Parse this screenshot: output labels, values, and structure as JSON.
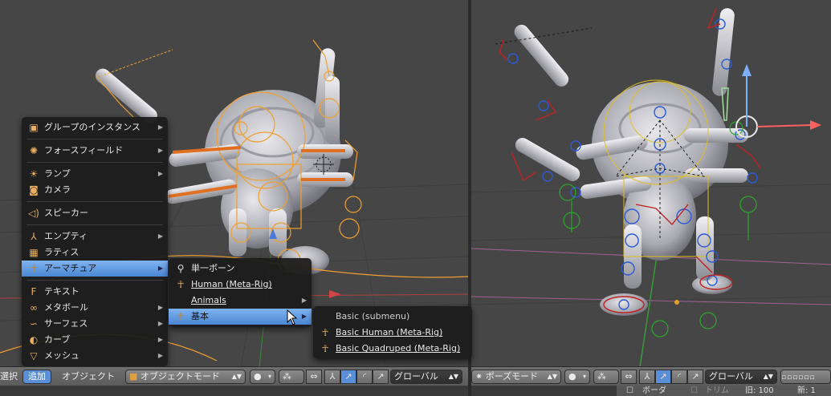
{
  "add_menu": {
    "items": [
      {
        "label": "グループのインスタンス",
        "icon": "group-icon",
        "submenu": true
      },
      {
        "label": "フォースフィールド",
        "icon": "force-field-icon",
        "submenu": true
      },
      {
        "label": "ランプ",
        "icon": "lamp-icon",
        "submenu": true
      },
      {
        "label": "カメラ",
        "icon": "camera-icon",
        "submenu": false
      },
      {
        "label": "スピーカー",
        "icon": "speaker-icon",
        "submenu": false
      },
      {
        "label": "エンプティ",
        "icon": "empty-icon",
        "submenu": true
      },
      {
        "label": "ラティス",
        "icon": "lattice-icon",
        "submenu": false
      },
      {
        "label": "アーマチュア",
        "icon": "armature-icon",
        "submenu": true
      },
      {
        "label": "テキスト",
        "icon": "text-icon",
        "submenu": false
      },
      {
        "label": "メタボール",
        "icon": "metaball-icon",
        "submenu": true
      },
      {
        "label": "サーフェス",
        "icon": "surface-icon",
        "submenu": true
      },
      {
        "label": "カーブ",
        "icon": "curve-icon",
        "submenu": true
      },
      {
        "label": "メッシュ",
        "icon": "mesh-icon",
        "submenu": true
      }
    ]
  },
  "armature_menu": {
    "items": [
      {
        "label": "単一ボーン",
        "icon": "bone-icon",
        "submenu": false
      },
      {
        "label": "Human (Meta-Rig)",
        "icon": "armature-icon",
        "submenu": false
      },
      {
        "label": "Animals",
        "icon": "",
        "submenu": true
      },
      {
        "label": "基本",
        "icon": "armature-icon",
        "submenu": true
      }
    ]
  },
  "basic_menu": {
    "items": [
      {
        "label": "Basic (submenu)",
        "icon": ""
      },
      {
        "label": "Basic Human (Meta-Rig)",
        "icon": "armature-icon"
      },
      {
        "label": "Basic Quadruped (Meta-Rig)",
        "icon": "armature-icon"
      }
    ]
  },
  "left_header": {
    "select_partial": "選択",
    "add": "追加",
    "object": "オブジェクト",
    "mode": "オブジェクトモード",
    "orientation": "グローバル"
  },
  "right_header": {
    "mode": "ポーズモード",
    "orientation": "グローバル"
  },
  "status_bar": {
    "border": "ボーダ",
    "trim": "トリム",
    "old": "旧: 100",
    "new": "新: 1"
  },
  "colors": {
    "viewport_bg": "#464646",
    "menu_bg": "#1c1c1c",
    "highlight": "#5a8ed6",
    "armature_orange": "#f0a030",
    "bone_blue": "#2a5ad8",
    "bone_red": "#d02020",
    "bone_green": "#2aa82a"
  }
}
